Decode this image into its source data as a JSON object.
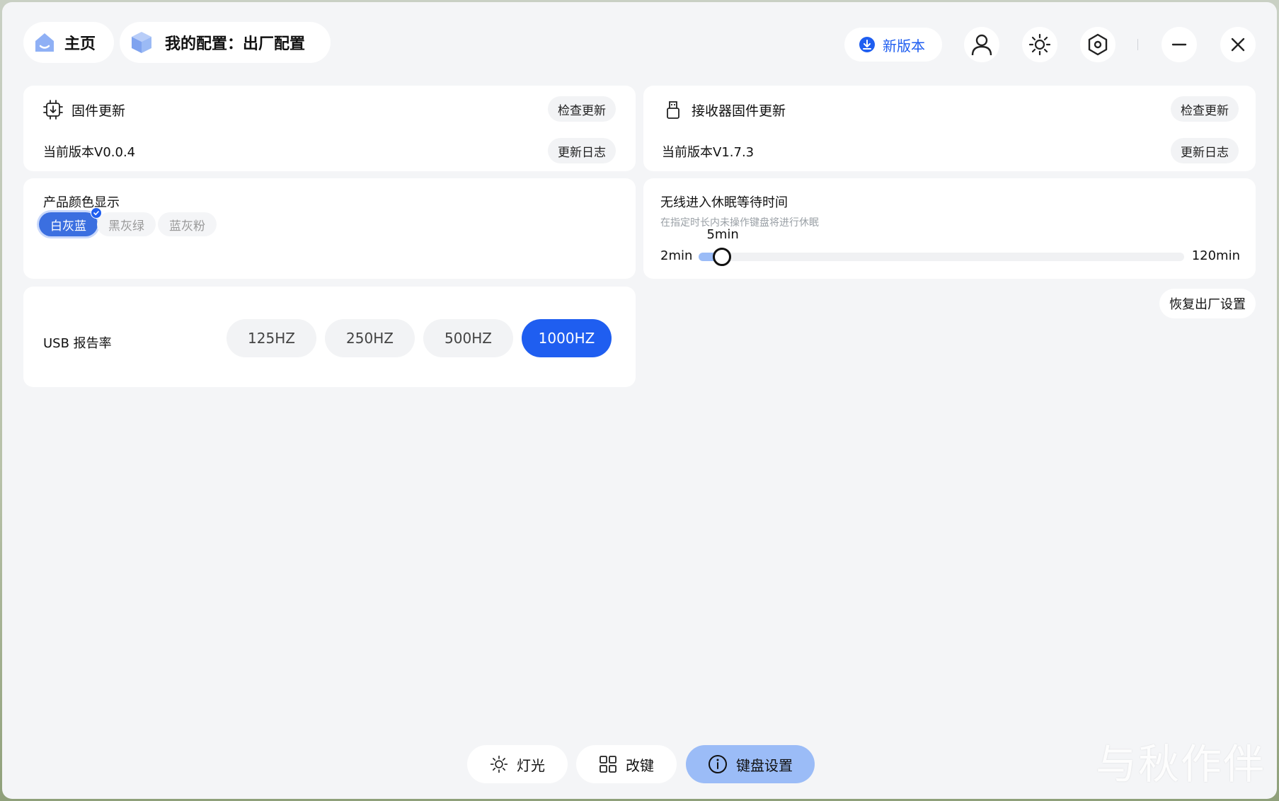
{
  "header": {
    "home_label": "主页",
    "config_label": "我的配置：出厂配置",
    "new_version_label": "新版本"
  },
  "firmware": {
    "title": "固件更新",
    "check_label": "检查更新",
    "version_text": "当前版本V0.0.4",
    "log_label": "更新日志"
  },
  "receiver": {
    "title": "接收器固件更新",
    "check_label": "检查更新",
    "version_text": "当前版本V1.7.3",
    "log_label": "更新日志"
  },
  "color_display": {
    "title": "产品颜色显示",
    "options": [
      "白灰蓝",
      "黑灰绿",
      "蓝灰粉"
    ],
    "selected": "白灰蓝"
  },
  "sleep": {
    "title": "无线进入休眠等待时间",
    "description": "在指定时长内未操作键盘将进行休眠",
    "min_label": "2min",
    "max_label": "120min",
    "value_label": "5min",
    "min": 2,
    "max": 120,
    "value": 5
  },
  "usb_rate": {
    "title": "USB 报告率",
    "options": [
      "125HZ",
      "250HZ",
      "500HZ",
      "1000HZ"
    ],
    "selected": "1000HZ"
  },
  "restore_label": "恢复出厂设置",
  "nav": {
    "lighting": "灯光",
    "remap": "改键",
    "keyboard_settings": "键盘设置",
    "active": "keyboard_settings"
  },
  "watermark": "与秋作伴",
  "colors": {
    "accent": "#1f5ef0",
    "accent_light": "#9bbcf7",
    "selected_chip": "#3b6fe0",
    "background": "#f4f5f7",
    "card": "#ffffff"
  }
}
